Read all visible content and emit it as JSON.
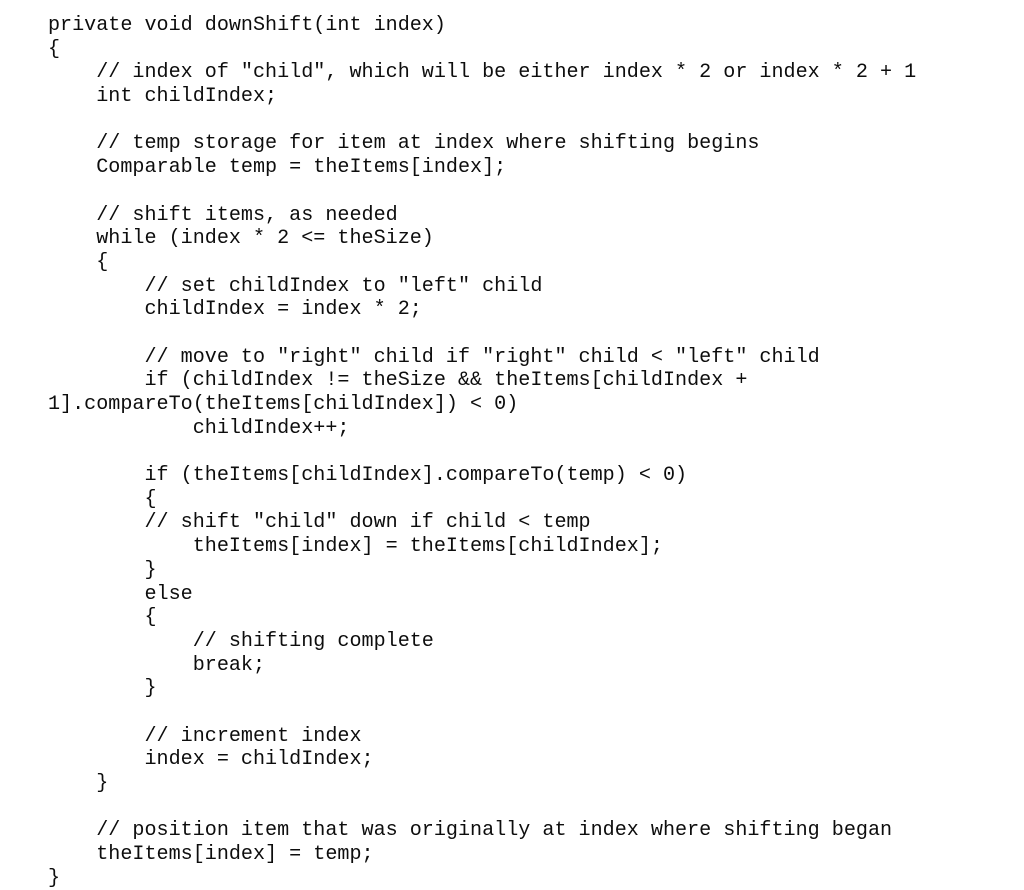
{
  "document": {
    "type": "source-code-listing",
    "language": "Java",
    "method_name": "downShift",
    "background_color": "#ffffff",
    "text_color": "#0d0d0d",
    "font_style": "monospace"
  },
  "code": {
    "lines": [
      "private void downShift(int index)",
      "{",
      "    // index of \"child\", which will be either index * 2 or index * 2 + 1",
      "    int childIndex;",
      "",
      "    // temp storage for item at index where shifting begins",
      "    Comparable temp = theItems[index];",
      "",
      "    // shift items, as needed",
      "    while (index * 2 <= theSize)",
      "    {",
      "        // set childIndex to \"left\" child",
      "        childIndex = index * 2;",
      "",
      "        // move to \"right\" child if \"right\" child < \"left\" child",
      "        if (childIndex != theSize && theItems[childIndex +",
      "1].compareTo(theItems[childIndex]) < 0)",
      "            childIndex++;",
      "",
      "        if (theItems[childIndex].compareTo(temp) < 0)",
      "        {",
      "        // shift \"child\" down if child < temp",
      "            theItems[index] = theItems[childIndex];",
      "        }",
      "        else",
      "        {",
      "            // shifting complete",
      "            break;",
      "        }",
      "",
      "        // increment index",
      "        index = childIndex;",
      "    }",
      "",
      "    // position item that was originally at index where shifting began",
      "    theItems[index] = temp;",
      "}"
    ]
  }
}
